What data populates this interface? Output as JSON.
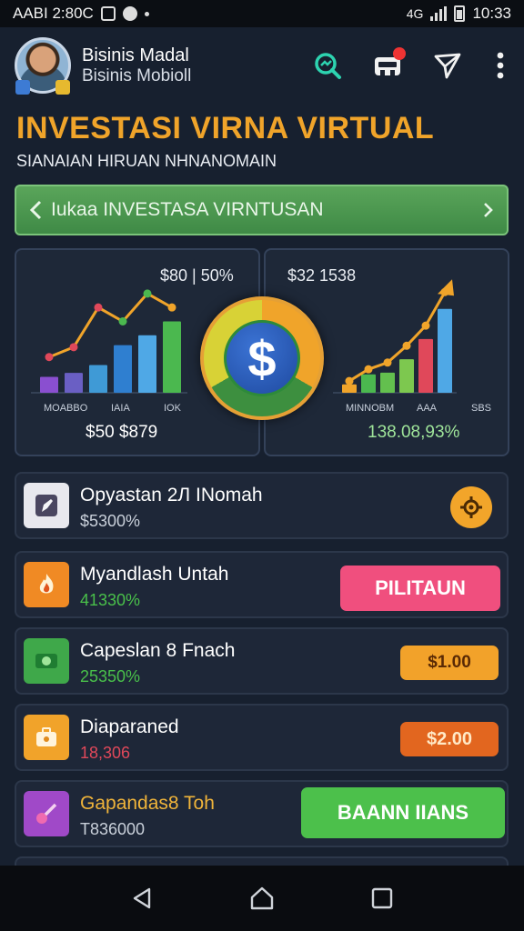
{
  "status_bar": {
    "left_text": "AABI 2:80C",
    "right_text": "10:33",
    "network_label": "4G"
  },
  "header": {
    "profile_name": "Bisinis Madal",
    "profile_subtitle": "Bisinis Mobioll",
    "icons": [
      "search-icon",
      "shop-icon",
      "send-icon",
      "more-vertical-icon"
    ]
  },
  "title": "INVESTASI VIRNA VIRTUAL",
  "subtitle": "SIANAIAN HIRUAN NHNANOMAIN",
  "banner": {
    "text": "Iukaa INVESTASA VIRNTUSAN"
  },
  "charts": {
    "left": {
      "head": "$80 | 50%",
      "foot": "$50 $879",
      "ticks": [
        "MOABBO",
        "IAIA",
        "IOK"
      ]
    },
    "right": {
      "head": "$32 1538",
      "foot": "138.08,93%",
      "ticks": [
        "MINNOBM",
        "AAA",
        "SBS"
      ]
    },
    "coin_symbol": "$"
  },
  "chart_data": [
    {
      "type": "bar",
      "categories": [
        "MOABBO",
        "IAIA",
        "IOK"
      ],
      "series": [
        {
          "values": [
            16,
            20,
            28,
            48,
            58,
            72
          ]
        },
        {
          "values": [
            36,
            46,
            86,
            72,
            100,
            86
          ]
        }
      ]
    },
    {
      "type": "bar",
      "categories": [
        "MINNOBM",
        "AAA",
        "SBS"
      ],
      "series": [
        {
          "values": [
            10,
            22,
            24,
            40,
            64,
            100
          ]
        },
        {
          "values": [
            14,
            28,
            36,
            56,
            80,
            120
          ]
        }
      ]
    }
  ],
  "items": [
    {
      "title": "Opyastan 2Л INomah",
      "value": "$5300%",
      "value_color": "#c9d0da",
      "icon": "pen-tool-icon",
      "icon_bg": "#e8e8ee",
      "action_type": "round",
      "action_icon": "gear-icon"
    },
    {
      "title": "Myandlash Untah",
      "value": "41330%",
      "value_color": "#49c04a",
      "icon": "fire-icon",
      "icon_bg": "#f08a24",
      "action_type": "button",
      "action_label": "PILITAUN",
      "action_bg": "#f04f7e",
      "action_color": "#ffffff"
    },
    {
      "title": "Capeslan 8 Fnach",
      "value": "25350%",
      "value_color": "#49c04a",
      "icon": "money-icon",
      "icon_bg": "#3fa84a",
      "action_type": "button",
      "action_label": "$1.00",
      "action_bg": "#f2a22a",
      "action_color": "#5a2a05"
    },
    {
      "title": "Diaparaned",
      "value": "18,306",
      "value_color": "#e0485a",
      "icon": "briefcase-icon",
      "icon_bg": "#f1a32a",
      "action_type": "button",
      "action_label": "$2.00",
      "action_bg": "#e2661f",
      "action_color": "#ffe9c6"
    },
    {
      "title": "Gapandas8 Toh",
      "value": "T836000",
      "value_color": "#c9d0da",
      "title_color": "#f0b43a",
      "icon": "key-icon",
      "icon_bg": "#a049c8",
      "action_type": "button",
      "action_label": "BAANN IIANS",
      "action_bg": "#4cc04b",
      "action_color": "#ffffff"
    }
  ]
}
